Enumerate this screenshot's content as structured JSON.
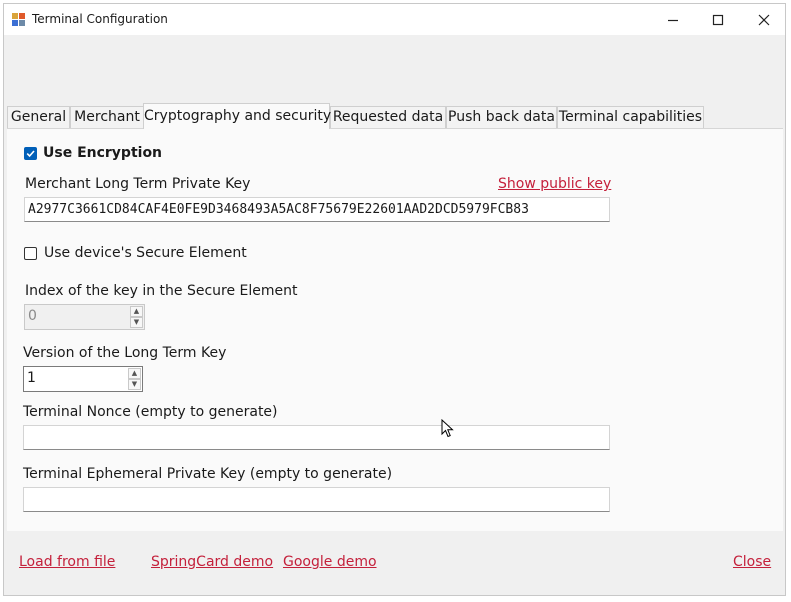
{
  "window": {
    "title": "Terminal Configuration"
  },
  "tabs": [
    {
      "label": "General"
    },
    {
      "label": "Merchant"
    },
    {
      "label": "Cryptography and security"
    },
    {
      "label": "Requested data"
    },
    {
      "label": "Push back data"
    },
    {
      "label": "Terminal capabilities"
    }
  ],
  "crypto": {
    "use_encryption": {
      "label": "Use Encryption",
      "checked": true
    },
    "private_key": {
      "label": "Merchant Long Term Private Key",
      "value": "A2977C3661CD84CAF4E0FE9D3468493A5AC8F75679E22601AAD2DCD5979FCB83",
      "show_public_key": "Show public key"
    },
    "secure_element": {
      "label": "Use device's Secure Element",
      "checked": false
    },
    "key_index": {
      "label": "Index of the key in the Secure Element",
      "value": "0"
    },
    "key_version": {
      "label": "Version of the Long Term Key",
      "value": "1"
    },
    "nonce": {
      "label": "Terminal Nonce (empty to generate)",
      "value": ""
    },
    "ephemeral_key": {
      "label": "Terminal Ephemeral Private Key (empty to generate)",
      "value": ""
    }
  },
  "footer": {
    "load_from_file": "Load from file",
    "springcard_demo": "SpringCard demo",
    "google_demo": "Google demo",
    "close": "Close"
  },
  "colors": {
    "link": "#c4203b",
    "checkbox_accent": "#005fb8"
  }
}
